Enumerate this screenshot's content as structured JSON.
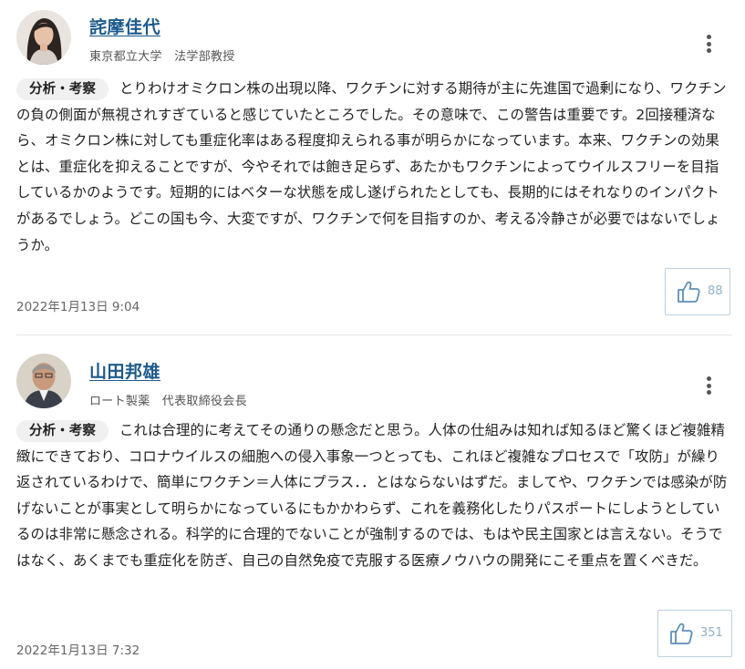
{
  "comments": [
    {
      "author": "詫摩佳代",
      "affiliation": "東京都立大学　法学部教授",
      "tag": "分析・考察",
      "text": "とりわけオミクロン株の出現以降、ワクチンに対する期待が主に先進国で過剰になり、ワクチンの負の側面が無視されすぎていると感じていたところでした。その意味で、この警告は重要です。2回接種済なら、オミクロン株に対しても重症化率はある程度抑えられる事が明らかになっています。本来、ワクチンの効果とは、重症化を抑えることですが、今やそれでは飽き足らず、あたかもワクチンによってウイルスフリーを目指しているかのようです。短期的にはベターな状態を成し遂げられたとしても、長期的にはそれなりのインパクトがあるでしょう。どこの国も今、大変ですが、ワクチンで何を目指すのか、考える冷静さが必要ではないでしょうか。",
      "likes": "88",
      "date": "2022年1月13日 9:04",
      "menu_icon": "more-vertical-icon",
      "like_icon": "thumbs-up-icon"
    },
    {
      "author": "山田邦雄",
      "affiliation": "ロート製薬　代表取締役会長",
      "tag": "分析・考察",
      "text": "これは合理的に考えてその通りの懸念だと思う。人体の仕組みは知れば知るほど驚くほど複雑精緻にできており、コロナウイルスの細胞への侵入事象一つとっても、これほど複雑なプロセスで「攻防」が繰り返されているわけで、簡単にワクチン＝人体にプラス．．とはならないはずだ。ましてや、ワクチンでは感染が防げないことが事実として明らかになっているにもかかわらず、これを義務化したりパスポートにしようとしているのは非常に懸念される。科学的に合理的でないことが強制するのでは、もはや民主国家とは言えない。そうではなく、あくまでも重症化を防ぎ、自己の自然免疫で克服する医療ノウハウの開発にこそ重点を置くべきだ。",
      "likes": "351",
      "date": "2022年1月13日 7:32",
      "menu_icon": "more-vertical-icon",
      "like_icon": "thumbs-up-icon"
    }
  ],
  "colors": {
    "author_link": "#1c5a8c",
    "like_border": "#bcd0e0",
    "like_count": "#8fb2cd",
    "tag_bg": "#f0f0f0"
  }
}
